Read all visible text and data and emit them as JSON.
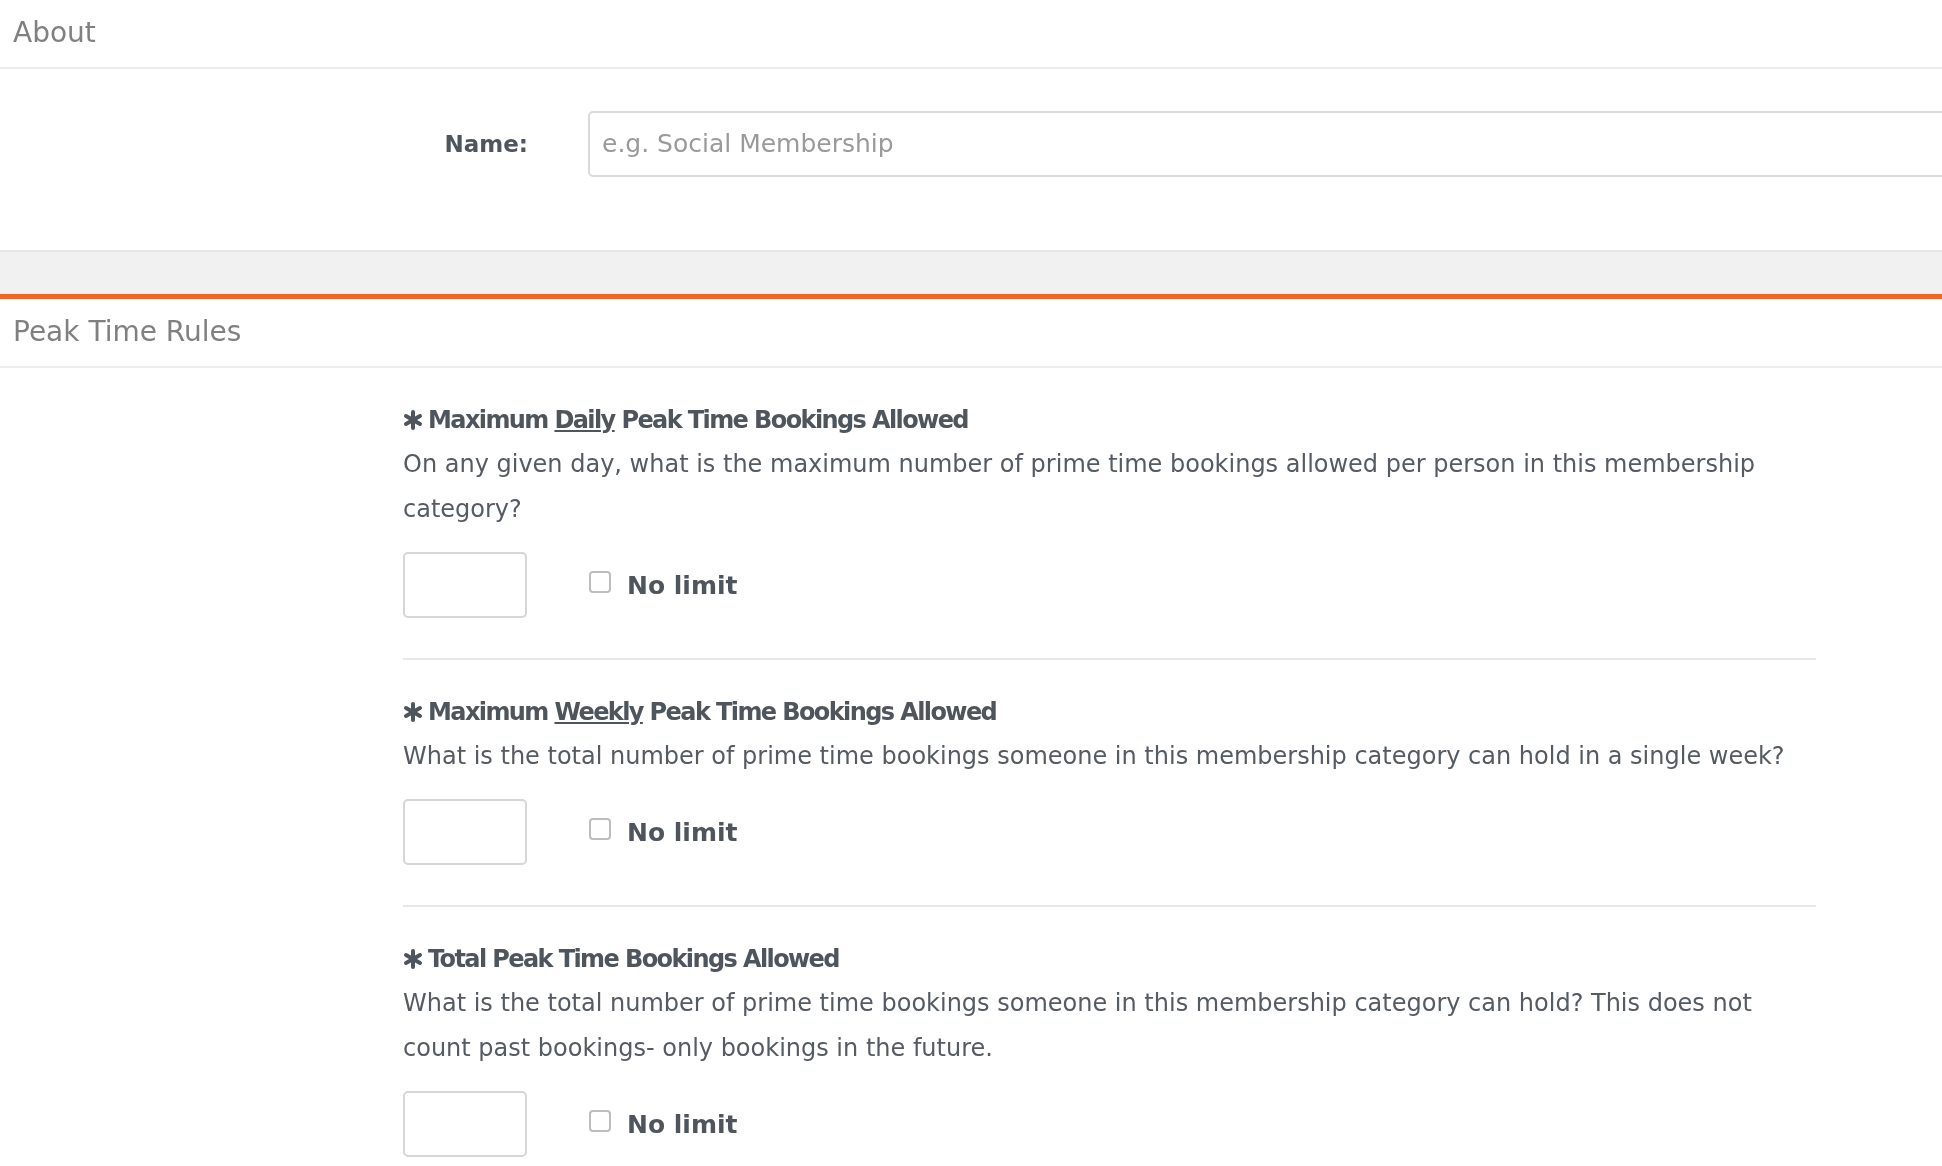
{
  "about": {
    "title": "About",
    "name_field": {
      "label": "Name:",
      "placeholder": "e.g. Social Membership"
    }
  },
  "peak_time_rules": {
    "title": "Peak Time Rules",
    "rules": [
      {
        "title": "Maximum *Daily* Peak Time Bookings Allowed",
        "description": "On any given day, what is the maximum number of prime time bookings allowed per person in this membership category?",
        "no_limit": {
          "label": "No limit",
          "checked": false
        }
      },
      {
        "title": "Maximum *Weekly* Peak Time Bookings Allowed",
        "description": "What is the total number of prime time bookings someone in this membership category can hold in a single week?",
        "no_limit": {
          "label": "No limit",
          "checked": false
        }
      },
      {
        "title": "Total Peak Time Bookings Allowed",
        "description": "What is the total number of prime time bookings someone in this membership category can hold? This does not count past bookings- only bookings in the future.",
        "no_limit": {
          "label": "No limit",
          "checked": false
        }
      }
    ]
  }
}
